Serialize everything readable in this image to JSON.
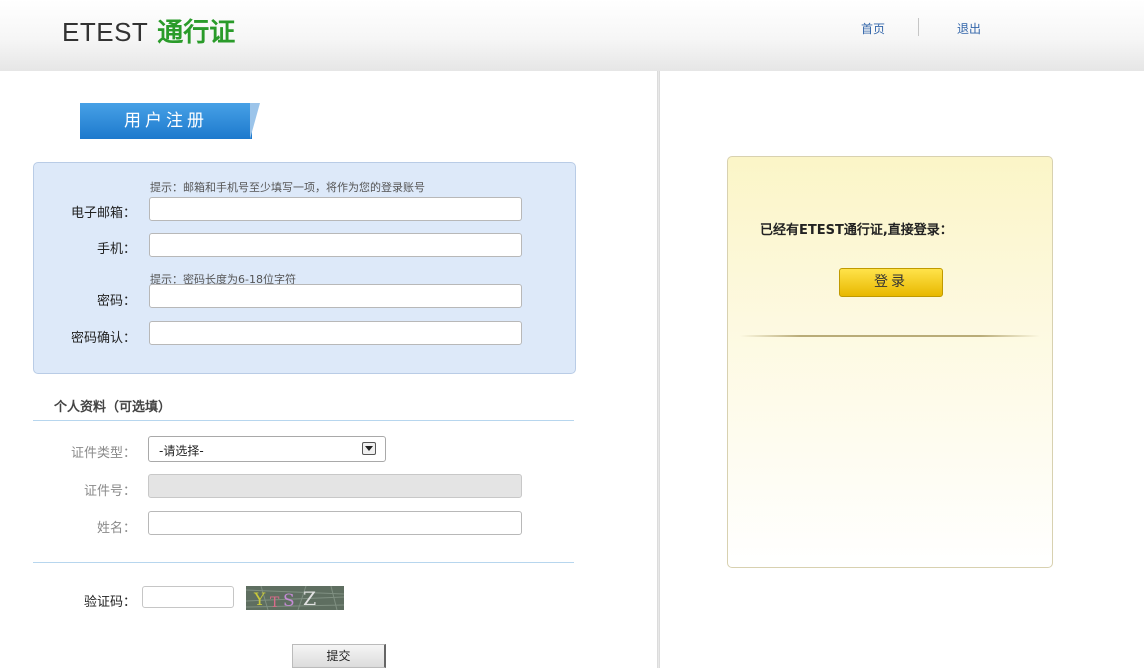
{
  "header": {
    "brand_en": "ETEST",
    "brand_cn": "通行证",
    "nav": {
      "home": "首页",
      "logout": "退出"
    }
  },
  "register": {
    "tab_label": "用户注册",
    "hint_account": "提示：邮箱和手机号至少填写一项，将作为您的登录账号",
    "email_label": "电子邮箱：",
    "email_value": "",
    "phone_label": "手机：",
    "phone_value": "",
    "hint_password": "提示：密码长度为6-18位字符",
    "password_label": "密码：",
    "password_value": "",
    "confirm_label": "密码确认：",
    "confirm_value": ""
  },
  "personal": {
    "title": "个人资料（可选填）",
    "id_type_label": "证件类型：",
    "id_type_selected": "-请选择-",
    "id_number_label": "证件号：",
    "name_label": "姓名：",
    "name_value": ""
  },
  "captcha": {
    "label": "验证码：",
    "value": "",
    "image_text": "YTSZ"
  },
  "submit_label": "提交",
  "login": {
    "prompt": "已经有ETEST通行证,直接登录：",
    "button_label": "登录"
  },
  "colors": {
    "brand_green": "#2a9b2a",
    "tab_blue": "#2b86d5",
    "panel_blue": "#dde9f9",
    "login_yellow": "#f5c800"
  }
}
